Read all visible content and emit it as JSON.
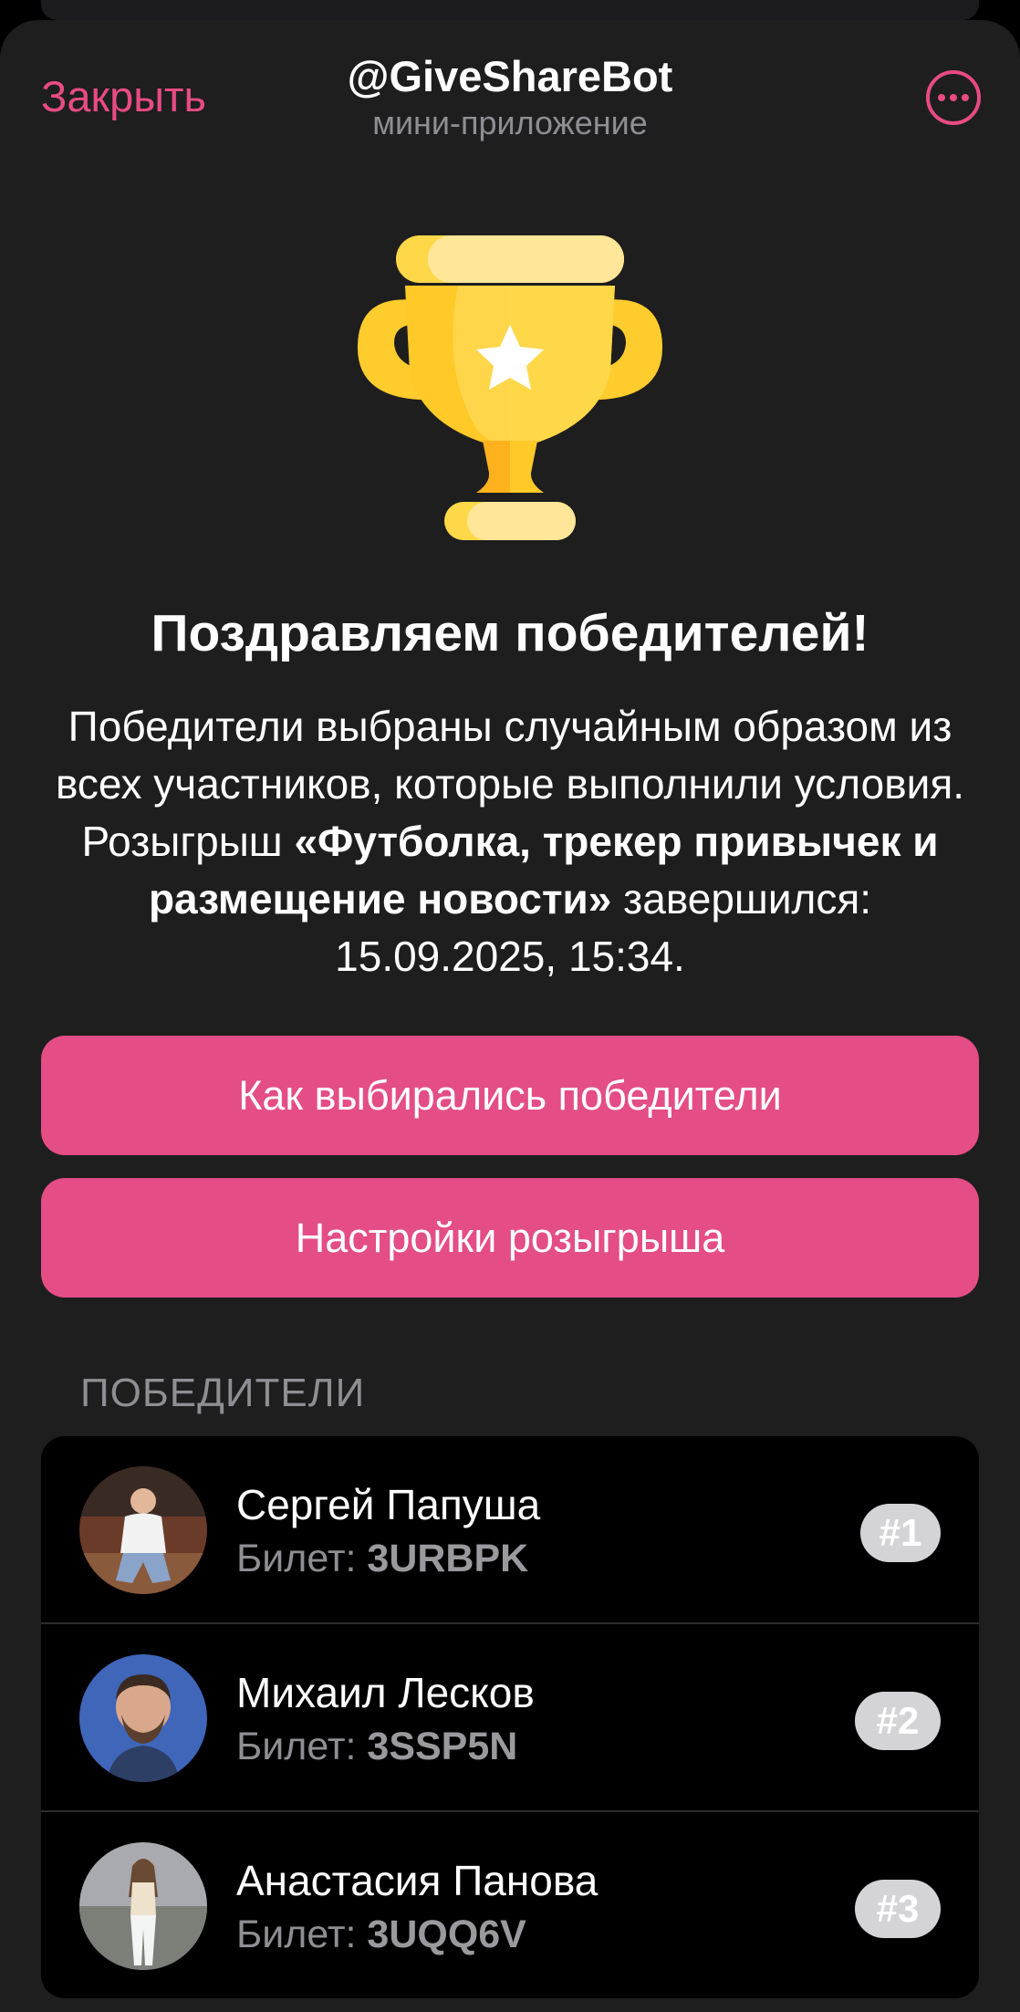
{
  "header": {
    "close_label": "Закрыть",
    "bot_name": "@GiveShareBot",
    "bot_subtitle": "мини-приложение",
    "more_icon": "more-icon"
  },
  "hero": {
    "icon": "trophy-icon",
    "title": "Поздравляем победителей!",
    "description_start": "Победители выбраны случайным образом из всех участников, которые выполнили условия. Розыгрыш ",
    "giveaway_name": "«Футболка, трекер привычек и размещение новости»",
    "description_end": " завершился: 15.09.2025, 15:34."
  },
  "buttons": {
    "how_selected": "Как выбирались победители",
    "settings": "Настройки розыгрыша"
  },
  "winners_section": {
    "label": "ПОБЕДИТЕЛИ",
    "ticket_label": "Билет: ",
    "items": [
      {
        "name": "Сергей Папуша",
        "ticket": "3URBPK",
        "rank": "#1"
      },
      {
        "name": "Михаил Лесков",
        "ticket": "3SSP5N",
        "rank": "#2"
      },
      {
        "name": "Анастасия Панова",
        "ticket": "3UQQ6V",
        "rank": "#3"
      }
    ]
  },
  "colors": {
    "accent": "#e44d86",
    "background": "#1e1e1e",
    "trophy_gold": "#ffc928"
  }
}
